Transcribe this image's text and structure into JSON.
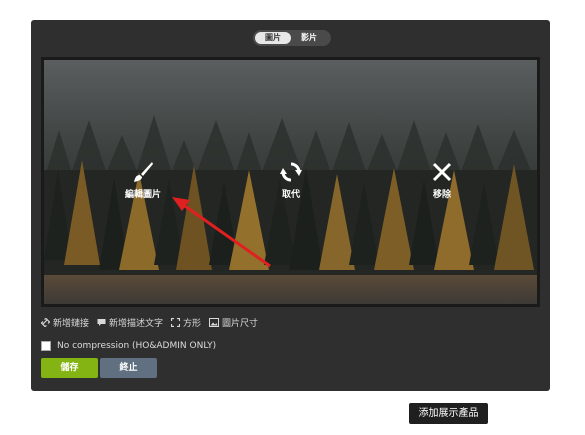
{
  "toggle": {
    "image_label": "圖片",
    "video_label": "影片"
  },
  "actions": {
    "edit": "編輯圖片",
    "replace": "取代",
    "remove": "移除"
  },
  "toolbar": {
    "add_link": "新增鏈接",
    "add_caption": "新增描述文字",
    "square": "方形",
    "image_size": "圖片尺寸"
  },
  "compression": {
    "label": "No compression (HO&ADMIN ONLY)",
    "checked": false
  },
  "buttons": {
    "save": "儲存",
    "cancel": "終止"
  },
  "tooltip": {
    "text": "添加展示產品"
  },
  "colors": {
    "panel": "#2f2f2f",
    "save": "#84b314",
    "cancel": "#607080",
    "arrow": "#e02020"
  }
}
